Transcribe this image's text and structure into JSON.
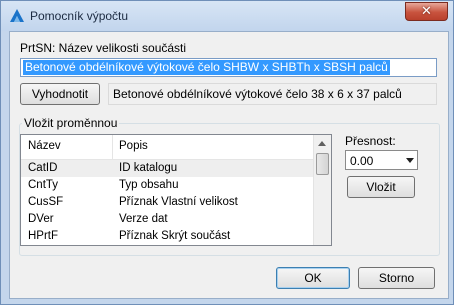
{
  "window": {
    "title": "Pomocník výpočtu",
    "close_glyph": "✕"
  },
  "part": {
    "label": "PrtSN: Název velikosti součásti",
    "expression": "Betonové obdélníkové výtokové čelo SHBW x SHBTh x SBSH palců"
  },
  "evaluate": {
    "button_label": "Vyhodnotit",
    "result": "Betonové obdélníkové výtokové čelo 38 x 6 x 37 palců"
  },
  "insert_variable": {
    "group_label": "Vložit proměnnou",
    "columns": [
      "Název",
      "Popis"
    ],
    "rows": [
      {
        "name": "CatID",
        "desc": "ID katalogu",
        "selected": true
      },
      {
        "name": "CntTy",
        "desc": "Typ obsahu",
        "selected": false
      },
      {
        "name": "CusSF",
        "desc": "Příznak Vlastní velikost",
        "selected": false
      },
      {
        "name": "DVer",
        "desc": "Verze dat",
        "selected": false
      },
      {
        "name": "HPrtF",
        "desc": "Příznak Skrýt součást",
        "selected": false
      }
    ],
    "precision_label": "Přesnost:",
    "precision_value": "0.00",
    "insert_button_label": "Vložit"
  },
  "footer": {
    "ok_label": "OK",
    "cancel_label": "Storno"
  },
  "colors": {
    "selection": "#3399ff",
    "title_bg": "#c4d6ec",
    "close_red": "#c8533e",
    "app_icon_blue": "#1a73c9"
  }
}
